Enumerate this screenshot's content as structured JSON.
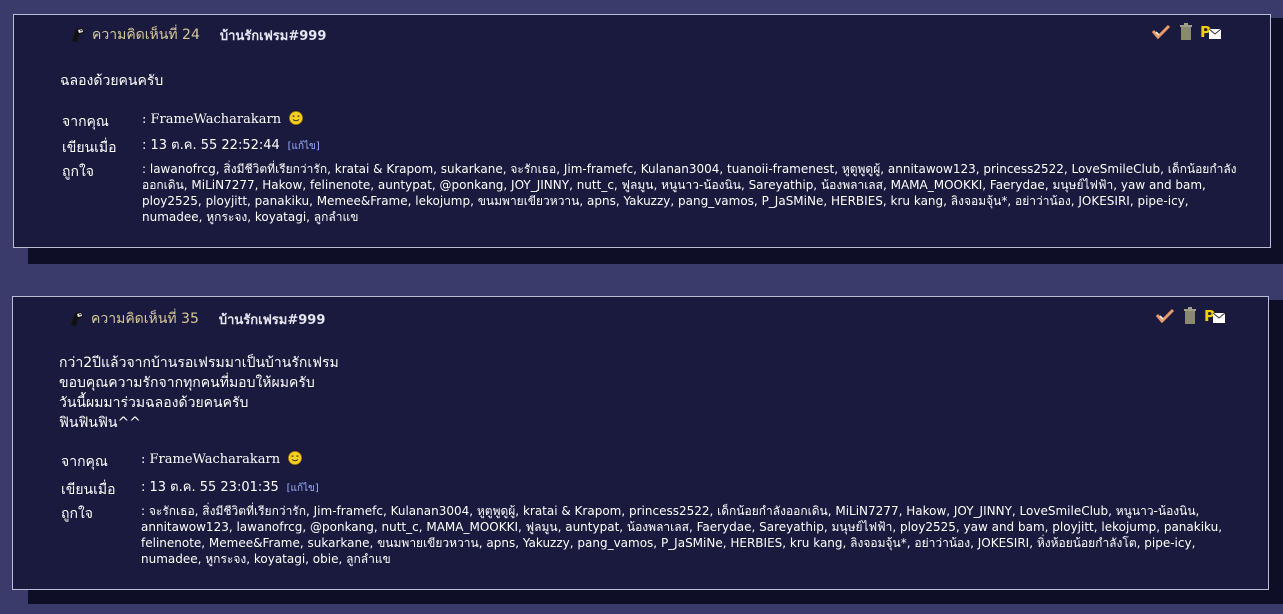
{
  "comments": [
    {
      "number_label": "ความคิดเห็นที่ 24",
      "author": "บ้านรักเฟรม#999",
      "body_lines": [
        "ฉลองด้วยคนครับ"
      ],
      "from_label": "จากคุณ",
      "from_value": ": FrameWacharakarn",
      "written_label": "เขียนเมื่อ",
      "written_value": ": 13 ต.ค. 55 22:52:44",
      "edit_label": "[แก้ไข]",
      "likes_label": "ถูกใจ",
      "likes_value": ": lawanofrcg, สิ่งมีชีวิตที่เรียกว่ารัก, kratai & Krapom, sukarkane, จะรักเธอ, Jim-framefc, Kulanan3004, tuanoii-framenest, หูตูพูดูผู้, annitawow123, princess2522, LoveSmileClub, เด็กน้อยกำลังออกเดิน, MiLiN7277, Hakow, felinenote, auntypat, @ponkang, JOY_JINNY, nutt_c, ฟูลมูน, หนูนาว-น้องนิน, Sareyathip, น้องพลาเลส, MAMA_MOOKKI, Faerydae, มนุษย์ไฟฟ้า, yaw and bam, ploy2525, ployjitt, panakiku, Memee&Frame, lekojump, ขนมพายเขียวหวาน, apns, Yakuzzy, pang_vamos, P_JaSMiNe, HERBIES, kru kang, ลิงจอมจุ้น*, อย่าว่าน้อง, JOKESIRI, pipe-icy, numadee, หูกระจง, koyatagi, ลูกลำแข"
    },
    {
      "number_label": "ความคิดเห็นที่ 35",
      "author": "บ้านรักเฟรม#999",
      "body_lines": [
        "กว่า2ปีแล้วจากบ้านรอเฟรมมาเป็นบ้านรักเฟรม",
        "ขอบคุณความรักจากทุกคนที่มอบให้ผมครับ",
        "วันนี้ผมมาร่วมฉลองด้วยคนครับ",
        "ฟินฟินฟิน^^"
      ],
      "from_label": "จากคุณ",
      "from_value": ": FrameWacharakarn",
      "written_label": "เขียนเมื่อ",
      "written_value": ": 13 ต.ค. 55 23:01:35",
      "edit_label": "[แก้ไข]",
      "likes_label": "ถูกใจ",
      "likes_value": ": จะรักเธอ, สิ่งมีชีวิตที่เรียกว่ารัก, Jim-framefc, Kulanan3004, หูตูพูดูผู้, kratai & Krapom, princess2522, เด็กน้อยกำลังออกเดิน, MiLiN7277, Hakow, JOY_JINNY, LoveSmileClub, หนูนาว-น้องนิน, annitawow123, lawanofrcg, @ponkang, nutt_c, MAMA_MOOKKI, ฟูลมูน, auntypat, น้องพลาเลส, Faerydae, Sareyathip, มนุษย์ไฟฟ้า, ploy2525, yaw and bam, ployjitt, lekojump, panakiku, felinenote, Memee&Frame, sukarkane, ขนมพายเขียวหวาน, apns, Yakuzzy, pang_vamos, P_JaSMiNe, HERBIES, kru kang, ลิงจอมจุ้น*, อย่าว่าน้อง, JOKESIRI, หิ่งห้อยน้อยกำลังโต, pipe-icy, numadee, หูกระจง, koyatagi, obie, ลูกลำแข"
    }
  ],
  "icons": {
    "avatar": "bird-avatar-icon",
    "approve": "check-heart-icon",
    "delete": "trash-icon",
    "message": "private-message-icon",
    "smile": "smiley-icon"
  },
  "colors": {
    "page_bg": "#3a3a6b",
    "box_bg": "#1a1a3e",
    "number": "#d7c99a",
    "edit_link": "#9ab0ff"
  }
}
